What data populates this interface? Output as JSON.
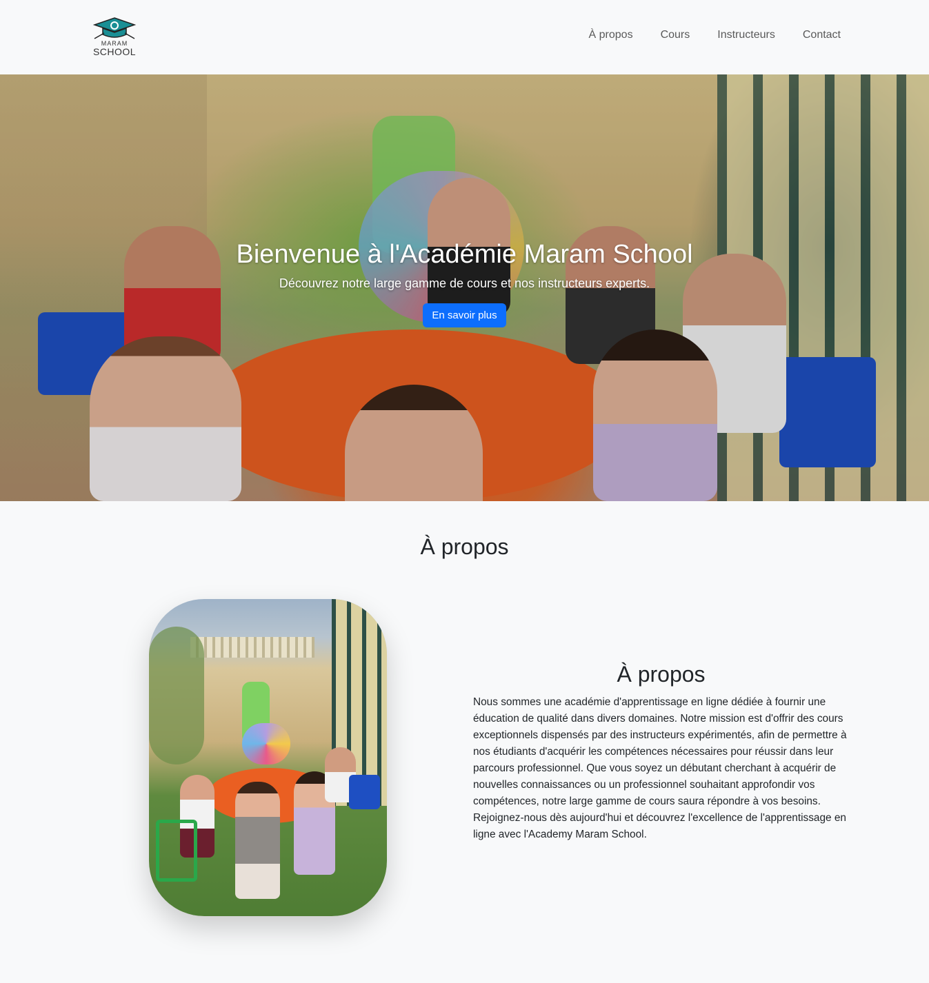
{
  "brand": {
    "logo_line1": "MARAM",
    "logo_line2": "SCHOOL",
    "accent": "#1a8f95"
  },
  "nav": {
    "items": [
      "À propos",
      "Cours",
      "Instructeurs",
      "Contact"
    ]
  },
  "hero": {
    "title": "Bienvenue à l'Académie Maram School",
    "subtitle": "Découvrez notre large gamme de cours et nos instructeurs experts.",
    "button_label": "En savoir plus",
    "button_color": "#0d6efd"
  },
  "about": {
    "section_title": "À propos",
    "subtitle": "À propos",
    "body": "Nous sommes une académie d'apprentissage en ligne dédiée à fournir une éducation de qualité dans divers domaines. Notre mission est d'offrir des cours exceptionnels dispensés par des instructeurs expérimentés, afin de permettre à nos étudiants d'acquérir les compétences nécessaires pour réussir dans leur parcours professionnel. Que vous soyez un débutant cherchant à acquérir de nouvelles connaissances ou un professionnel souhaitant approfondir vos compétences, notre large gamme de cours saura répondre à vos besoins. Rejoignez-nous dès aujourd'hui et découvrez l'excellence de l'apprentissage en ligne avec l'Academy Maram School."
  }
}
